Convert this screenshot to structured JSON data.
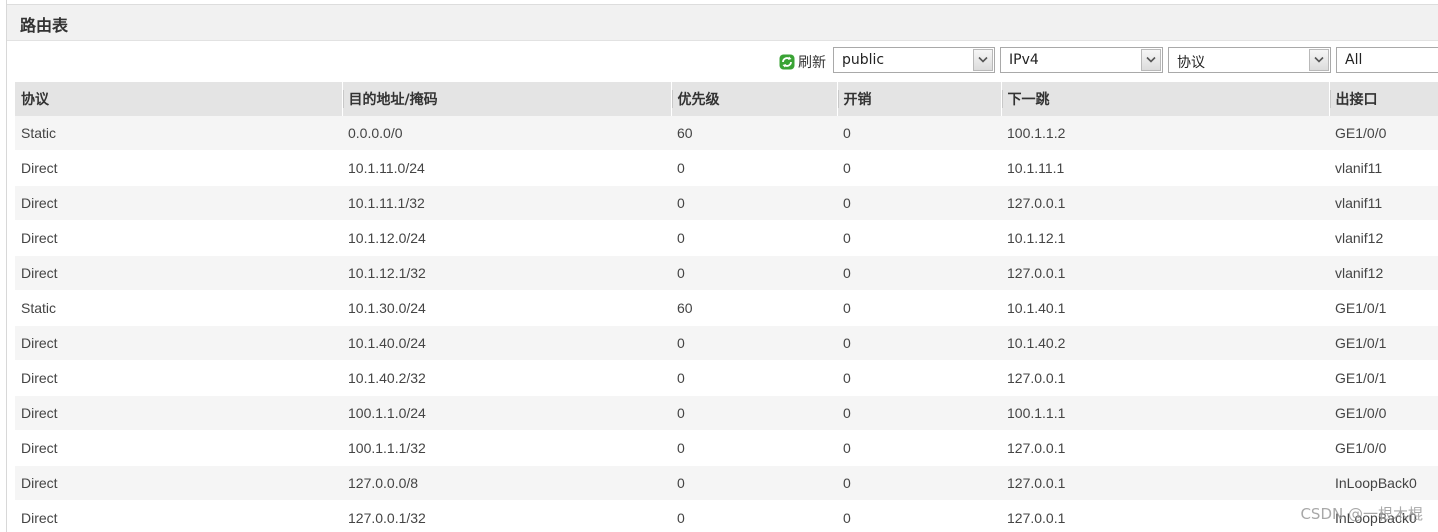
{
  "panel": {
    "title": "路由表"
  },
  "toolbar": {
    "refresh_label": "刷新",
    "vpn_select": "public",
    "ip_version_select": "IPv4",
    "protocol_select": "协议",
    "filter_select": "All"
  },
  "table": {
    "columns": [
      "协议",
      "目的地址/掩码",
      "优先级",
      "开销",
      "下一跳",
      "出接口"
    ],
    "rows": [
      [
        "Static",
        "0.0.0.0/0",
        "60",
        "0",
        "100.1.1.2",
        "GE1/0/0"
      ],
      [
        "Direct",
        "10.1.11.0/24",
        "0",
        "0",
        "10.1.11.1",
        "vlanif11"
      ],
      [
        "Direct",
        "10.1.11.1/32",
        "0",
        "0",
        "127.0.0.1",
        "vlanif11"
      ],
      [
        "Direct",
        "10.1.12.0/24",
        "0",
        "0",
        "10.1.12.1",
        "vlanif12"
      ],
      [
        "Direct",
        "10.1.12.1/32",
        "0",
        "0",
        "127.0.0.1",
        "vlanif12"
      ],
      [
        "Static",
        "10.1.30.0/24",
        "60",
        "0",
        "10.1.40.1",
        "GE1/0/1"
      ],
      [
        "Direct",
        "10.1.40.0/24",
        "0",
        "0",
        "10.1.40.2",
        "GE1/0/1"
      ],
      [
        "Direct",
        "10.1.40.2/32",
        "0",
        "0",
        "127.0.0.1",
        "GE1/0/1"
      ],
      [
        "Direct",
        "100.1.1.0/24",
        "0",
        "0",
        "100.1.1.1",
        "GE1/0/0"
      ],
      [
        "Direct",
        "100.1.1.1/32",
        "0",
        "0",
        "127.0.0.1",
        "GE1/0/0"
      ],
      [
        "Direct",
        "127.0.0.0/8",
        "0",
        "0",
        "127.0.0.1",
        "InLoopBack0"
      ],
      [
        "Direct",
        "127.0.0.1/32",
        "0",
        "0",
        "127.0.0.1",
        "InLoopBack0"
      ]
    ]
  },
  "watermark": "CSDN @一根木棍",
  "colors": {
    "header_bg": "#f1f1f1",
    "table_header_bg": "#e4e4e4",
    "row_odd_bg": "#f5f5f5",
    "row_even_bg": "#ffffff",
    "refresh_icon": "#3aa335"
  }
}
